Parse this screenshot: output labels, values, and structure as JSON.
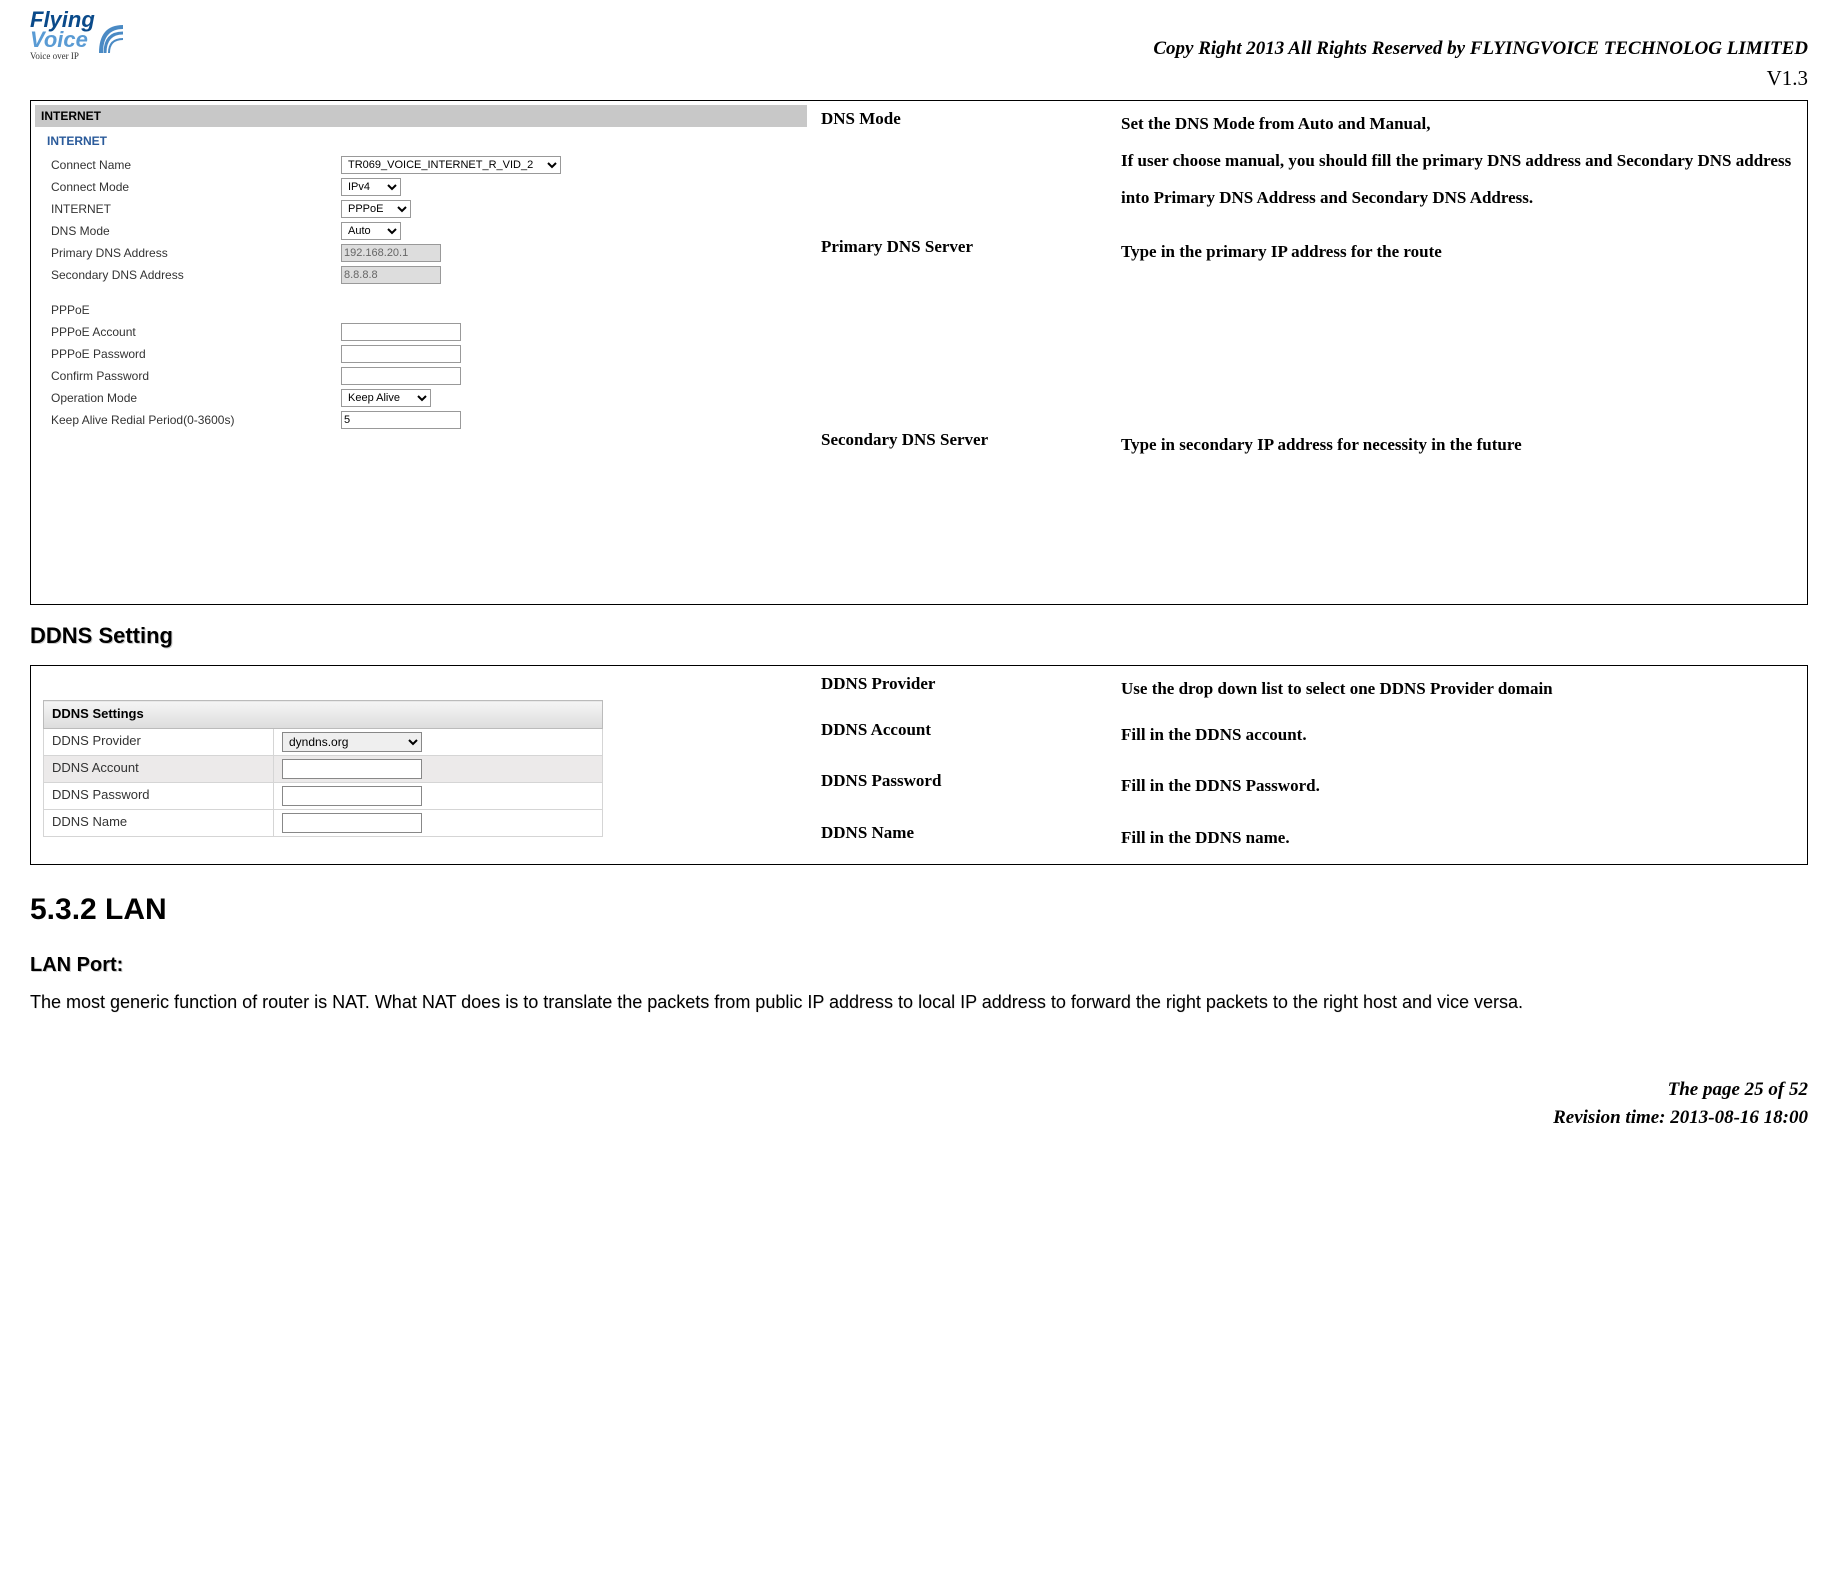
{
  "header": {
    "logo_line1": "Flying",
    "logo_line2": "Voice",
    "logo_sub": "Voice over IP",
    "copyright": "Copy Right 2013 All Rights Reserved by FLYINGVOICE TECHNOLOG LIMITED",
    "version": "V1.3"
  },
  "internet_panel": {
    "title": "INTERNET",
    "subtitle": "INTERNET",
    "rows": {
      "connect_name": {
        "label": "Connect Name",
        "value": "TR069_VOICE_INTERNET_R_VID_2"
      },
      "connect_mode": {
        "label": "Connect Mode",
        "value": "IPv4"
      },
      "internet": {
        "label": "INTERNET",
        "value": "PPPoE"
      },
      "dns_mode": {
        "label": "DNS Mode",
        "value": "Auto"
      },
      "primary_dns": {
        "label": "Primary DNS Address",
        "value": "192.168.20.1"
      },
      "secondary_dns": {
        "label": "Secondary DNS Address",
        "value": "8.8.8.8"
      },
      "pppoe_section": "PPPoE",
      "pppoe_account": {
        "label": "PPPoE Account",
        "value": ""
      },
      "pppoe_password": {
        "label": "PPPoE Password",
        "value": ""
      },
      "confirm_password": {
        "label": "Confirm Password",
        "value": ""
      },
      "operation_mode": {
        "label": "Operation Mode",
        "value": "Keep Alive"
      },
      "keep_alive": {
        "label": "Keep Alive Redial Period(0-3600s)",
        "value": "5"
      }
    }
  },
  "internet_desc": [
    {
      "name": "DNS Mode",
      "value": "Set the DNS Mode from Auto and Manual,\nIf user choose manual, you should fill the primary DNS address and Secondary DNS address into Primary DNS Address and Secondary DNS Address."
    },
    {
      "name": "Primary DNS Server",
      "value": "Type in the primary IP address for the route"
    },
    {
      "name": "Secondary DNS Server",
      "value": "Type in secondary IP address for necessity in the future"
    }
  ],
  "ddns_heading": "DDNS Setting",
  "ddns_panel": {
    "title": "DDNS Settings",
    "rows": {
      "provider": {
        "label": "DDNS Provider",
        "value": "dyndns.org"
      },
      "account": {
        "label": "DDNS Account",
        "value": ""
      },
      "password": {
        "label": "DDNS Password",
        "value": ""
      },
      "name": {
        "label": "DDNS Name",
        "value": ""
      }
    }
  },
  "ddns_desc": [
    {
      "name": "DDNS Provider",
      "value": "Use the drop down list to select one DDNS Provider domain"
    },
    {
      "name": "DDNS Account",
      "value": "Fill in the DDNS account."
    },
    {
      "name": "DDNS Password",
      "value": "Fill in the DDNS Password."
    },
    {
      "name": "DDNS Name",
      "value": "Fill in the DDNS name."
    }
  ],
  "lan": {
    "heading": "5.3.2 LAN",
    "sub": "LAN Port:",
    "para": "The most generic function of router is NAT. What NAT does is to translate the packets from public IP address to local IP address to forward the right packets to the right host and vice versa."
  },
  "footer": {
    "page": "The page 25 of 52",
    "revision": "Revision time: 2013-08-16 18:00"
  }
}
